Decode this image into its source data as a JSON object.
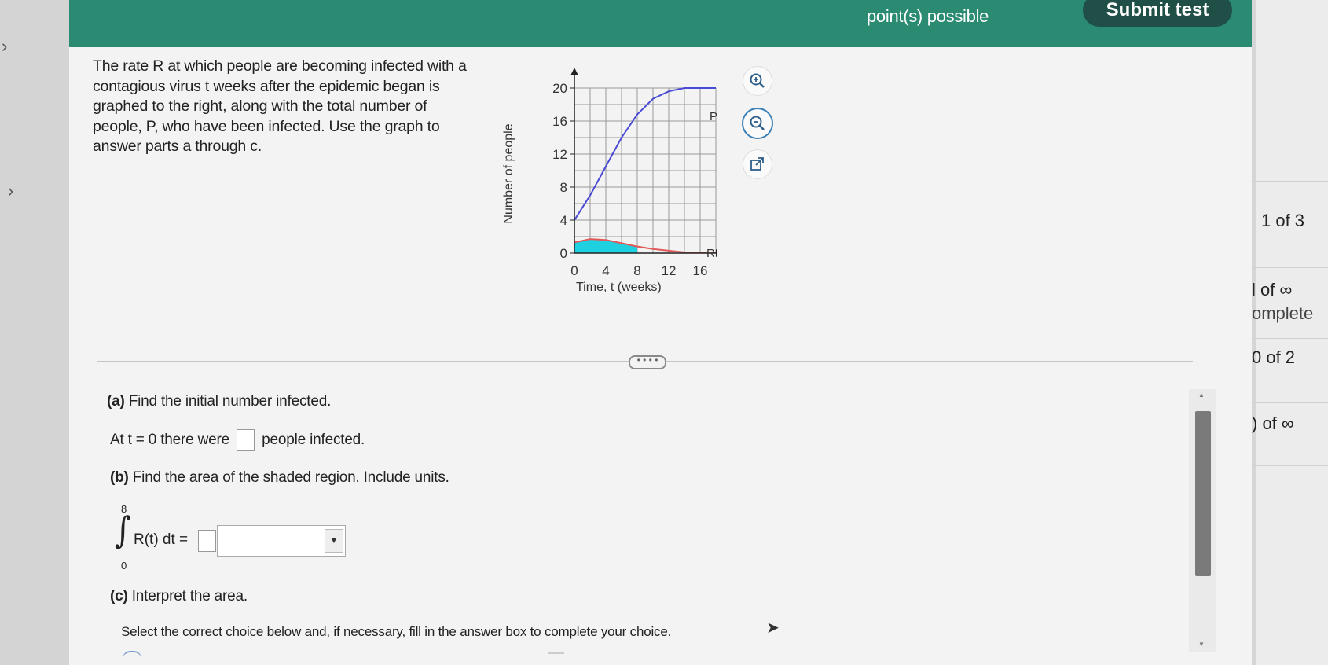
{
  "header": {
    "points_text": "point(s) possible",
    "submit_label": "Submit test"
  },
  "problem": {
    "text": "The rate R at which people are becoming infected with a contagious virus t weeks after the epidemic began is graphed to the right, along with the total number of people, P, who have been infected. Use the graph to answer parts a through c."
  },
  "graph": {
    "ylabel": "Number of people",
    "xlabel": "Time, t (weeks)",
    "yticks": [
      "20",
      "16",
      "12",
      "8",
      "4",
      "0"
    ],
    "xticks": [
      "0",
      "4",
      "8",
      "12",
      "16"
    ],
    "label_P": "P",
    "label_R": "R",
    "colors": {
      "P": "#4a4ad6",
      "R": "#e05a5a",
      "shade": "#1fd0e0"
    }
  },
  "chart_data": {
    "type": "line",
    "xlabel": "Time, t (weeks)",
    "ylabel": "Number of people",
    "xlim": [
      0,
      18
    ],
    "ylim": [
      0,
      20
    ],
    "grid": true,
    "series": [
      {
        "name": "P",
        "x": [
          0,
          2,
          4,
          6,
          8,
          10,
          12,
          14,
          16,
          18
        ],
        "values": [
          4,
          7,
          10.5,
          14,
          16.8,
          18.7,
          19.6,
          20,
          20,
          20
        ]
      },
      {
        "name": "R",
        "x": [
          0,
          2,
          4,
          6,
          8,
          10,
          12,
          14,
          16,
          18
        ],
        "values": [
          1.3,
          1.7,
          1.6,
          1.2,
          0.8,
          0.5,
          0.3,
          0.1,
          0.05,
          0.05
        ]
      }
    ],
    "shaded_region": {
      "under": "R",
      "from": 0,
      "to": 8
    }
  },
  "toolbar": {
    "zoom_in": "zoom-in",
    "zoom_out": "zoom-out",
    "popout": "open-in-new-window"
  },
  "questions": {
    "a_label": "(a)",
    "a_text": "Find the initial number infected.",
    "a_answer_pre": "At t = 0 there were",
    "a_answer_post": "people infected.",
    "b_label": "(b)",
    "b_text": "Find the area of the shaded region. Include units.",
    "integral_upper": "8",
    "integral_lower": "0",
    "integral_expr": "R(t) dt =",
    "c_label": "(c)",
    "c_text": "Interpret the area.",
    "select_text": "Select the correct choice below and, if necessary, fill in the answer box to complete your choice."
  },
  "right_panel": [
    "1 of 3",
    "l of ∞",
    "omplete",
    "0 of 2",
    ") of ∞"
  ]
}
